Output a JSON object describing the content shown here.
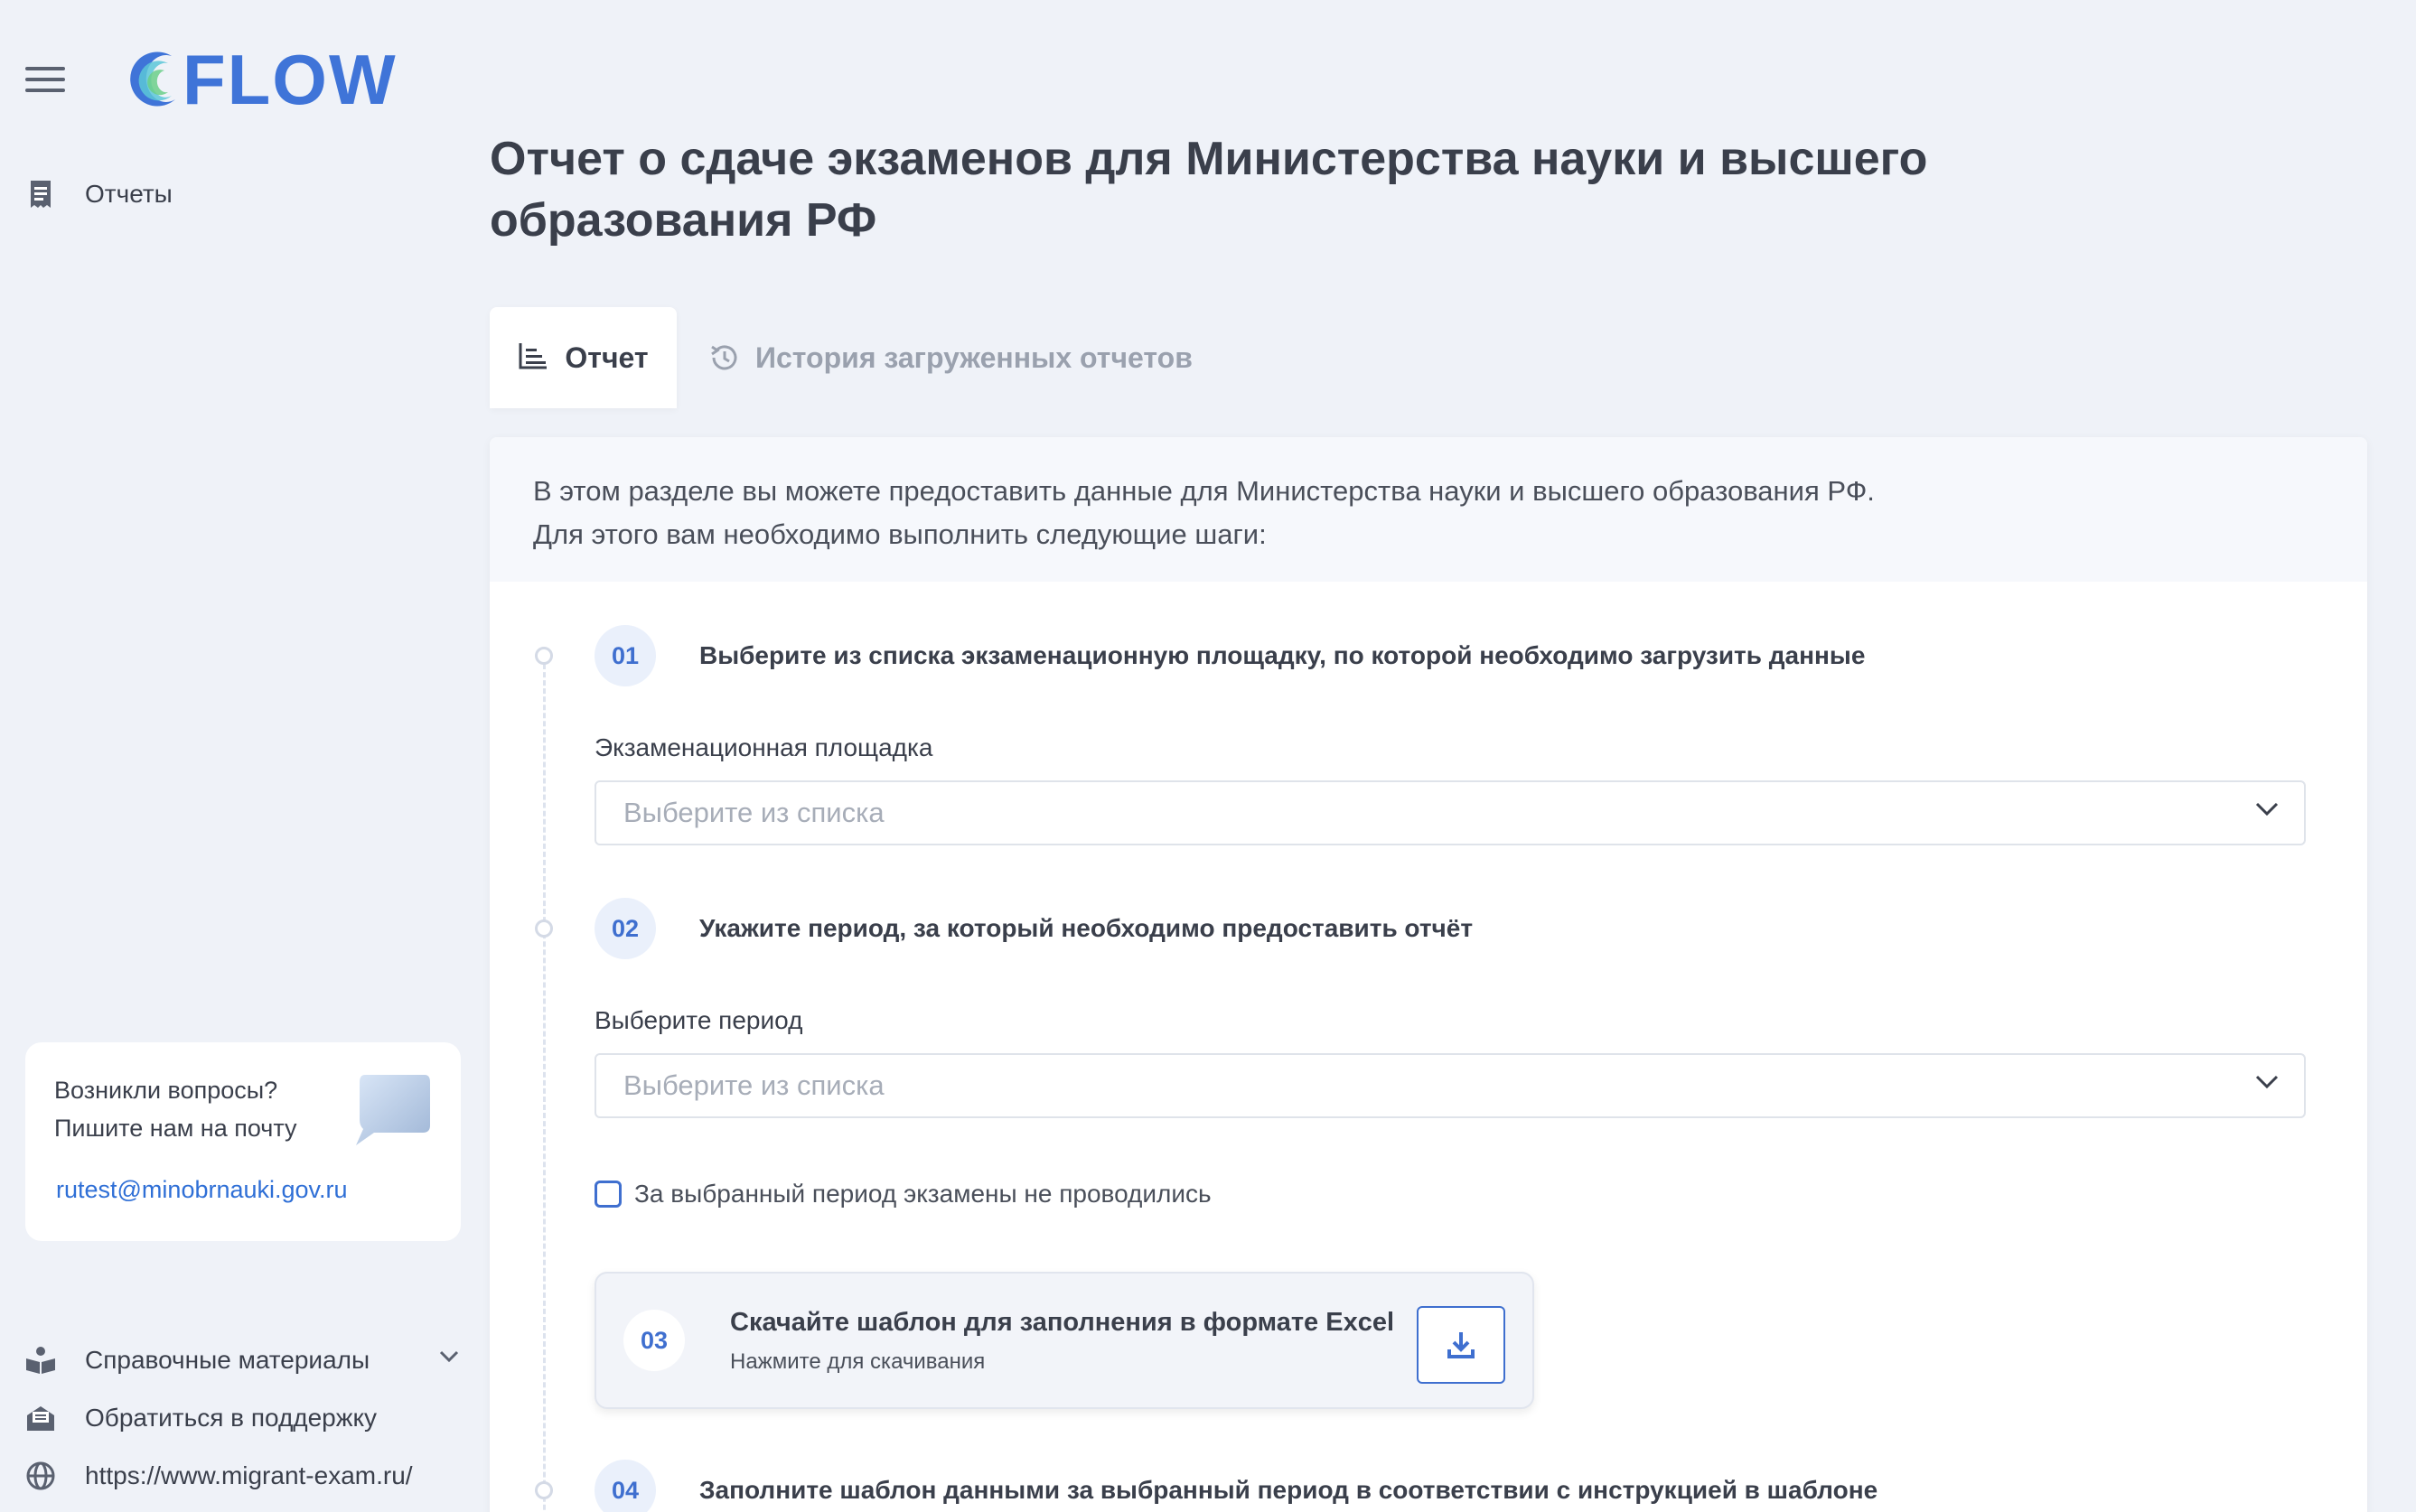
{
  "app": {
    "logo_text": "FLOW"
  },
  "sidebar": {
    "reports_label": "Отчеты",
    "help": {
      "question_line1": "Возникли вопросы?",
      "question_line2": "Пишите нам на почту",
      "email": "rutest@minobrnauki.gov.ru"
    },
    "bottom": {
      "references_label": "Справочные материалы",
      "support_label": "Обратиться в поддержку",
      "site_label": "https://www.migrant-exam.ru/"
    }
  },
  "page": {
    "title_line1": "Отчет о сдаче экзаменов для Министерства науки и высшего",
    "title_line2": "образования РФ"
  },
  "tabs": {
    "report": "Отчет",
    "history": "История загруженных отчетов"
  },
  "intro": {
    "line1": "В этом разделе вы можете предоставить данные для Министерства науки и высшего образования РФ.",
    "line2": "Для этого вам необходимо выполнить следующие шаги:"
  },
  "steps": {
    "s1": {
      "num": "01",
      "title": "Выберите из списка экзаменационную площадку, по которой необходимо загрузить данные",
      "field_label": "Экзаменационная площадка",
      "placeholder": "Выберите из списка"
    },
    "s2": {
      "num": "02",
      "title": "Укажите период, за который необходимо предоставить отчёт",
      "field_label": "Выберите период",
      "placeholder": "Выберите из списка",
      "checkbox_label": "За выбранный период экзамены не проводились"
    },
    "s3": {
      "num": "03",
      "title": "Скачайте шаблон для заполнения в формате Excel",
      "subtitle": "Нажмите для скачивания"
    },
    "s4": {
      "num": "04",
      "title": "Заполните шаблон данными за выбранный период в соответствии с инструкцией в шаблоне"
    }
  },
  "colors": {
    "accent": "#3f6fcf",
    "logo": "#3f74d8",
    "background": "#eff2f8"
  }
}
